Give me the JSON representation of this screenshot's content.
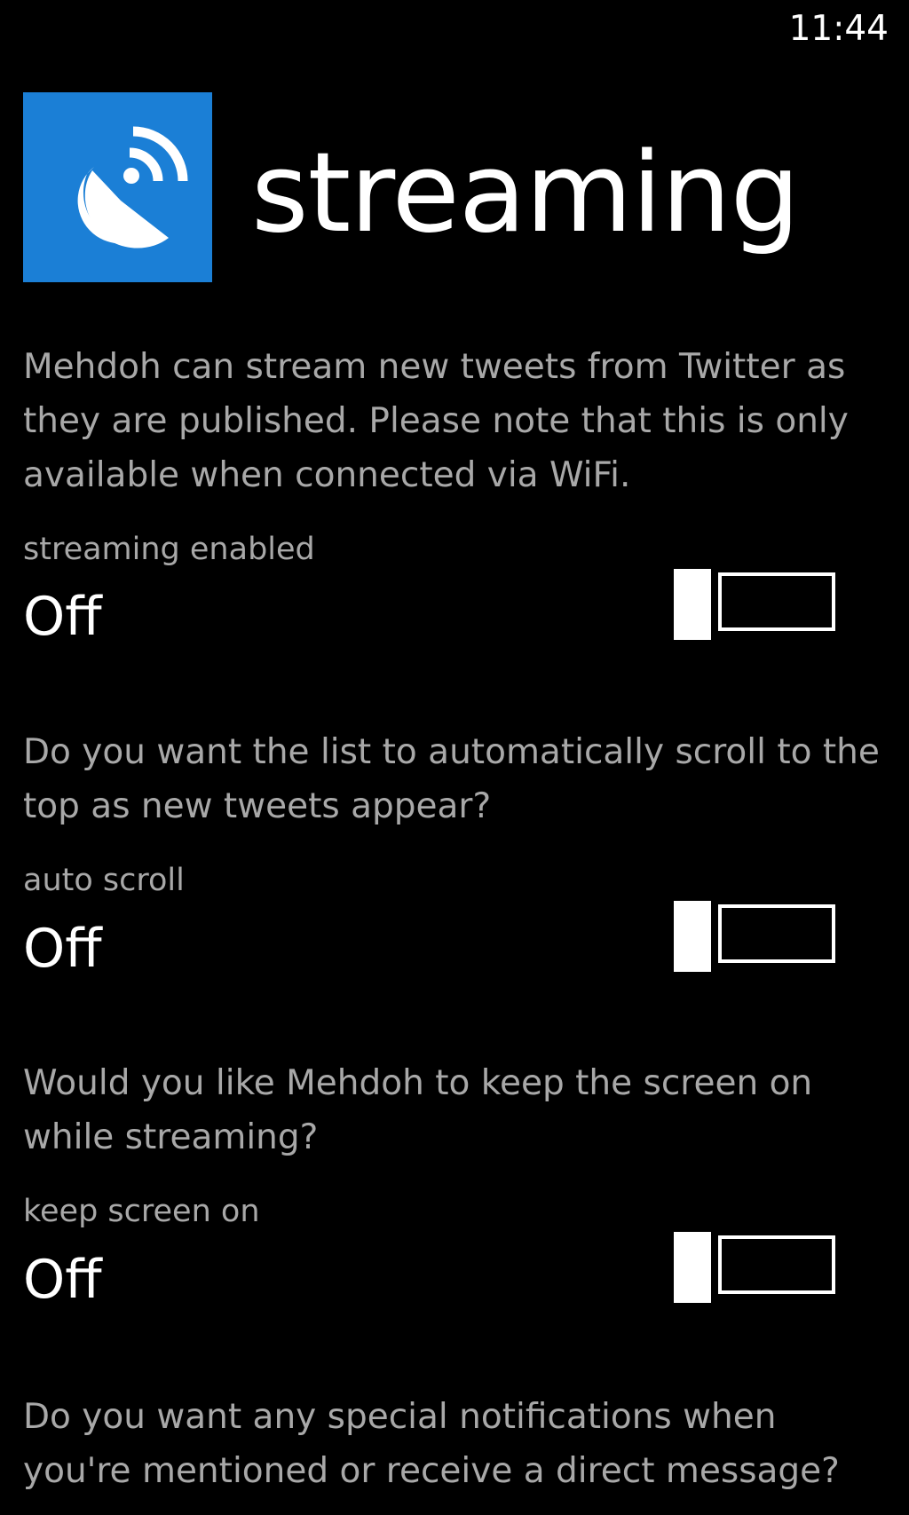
{
  "status_bar": {
    "time": "11:44"
  },
  "header": {
    "tile_color": "#1b7fd6",
    "tile_icon": "satellite-dish-icon",
    "title": "streaming"
  },
  "sections": [
    {
      "description": "Mehdoh can stream new tweets from Twitter as they are published. Please note that this is only available when connected via WiFi.",
      "toggle_label": "streaming enabled",
      "toggle_value": "Off",
      "toggle_on": false
    },
    {
      "description": "Do you want the list to automatically scroll to the top as new tweets appear?",
      "toggle_label": "auto scroll",
      "toggle_value": "Off",
      "toggle_on": false
    },
    {
      "description": "Would you like Mehdoh to keep the screen on while streaming?",
      "toggle_label": "keep screen on",
      "toggle_value": "Off",
      "toggle_on": false
    },
    {
      "description": "Do you want any special notifications when you're mentioned or receive a direct message?"
    }
  ]
}
